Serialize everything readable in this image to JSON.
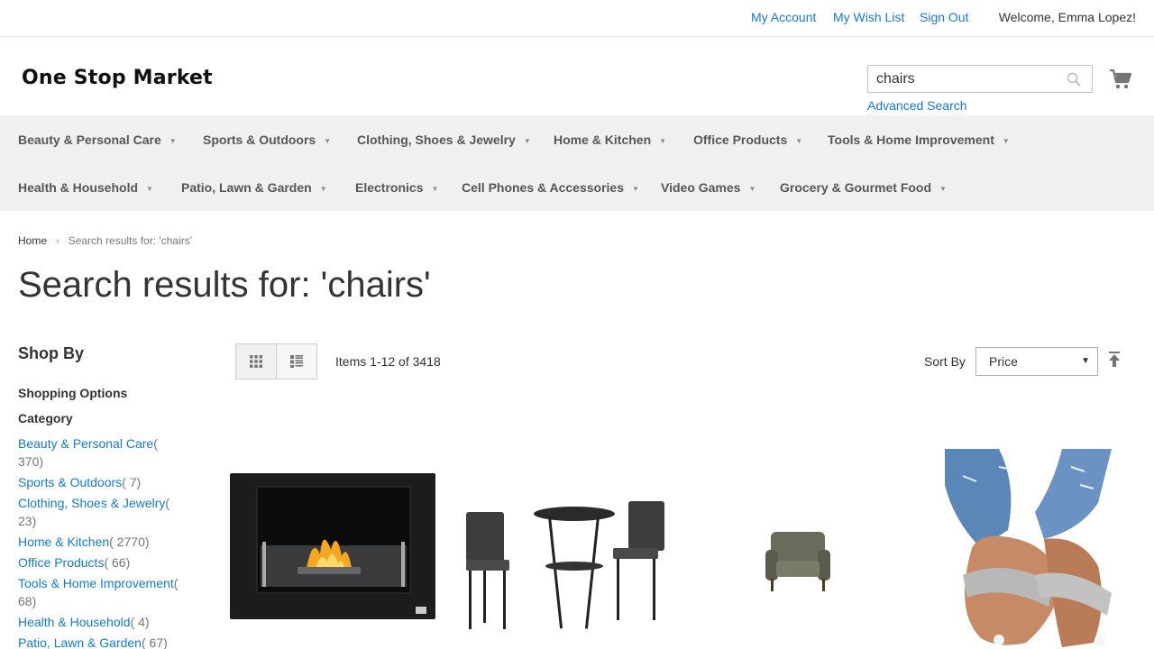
{
  "topbar": {
    "my_account": "My Account",
    "wish_list": "My Wish List",
    "sign_out": "Sign Out",
    "welcome": "Welcome, Emma Lopez!"
  },
  "header": {
    "logo": "One Stop Market",
    "search_value": "chairs",
    "advanced_search": "Advanced Search"
  },
  "nav": {
    "row1": [
      "Beauty & Personal Care",
      "Sports & Outdoors",
      "Clothing, Shoes & Jewelry",
      "Home & Kitchen",
      "Office Products",
      "Tools & Home Improvement"
    ],
    "row2": [
      "Health & Household",
      "Patio, Lawn & Garden",
      "Electronics",
      "Cell Phones & Accessories",
      "Video Games",
      "Grocery & Gourmet Food"
    ]
  },
  "breadcrumb": {
    "home": "Home",
    "current": "Search results for: 'chairs'"
  },
  "page_title": "Search results for: 'chairs'",
  "sidebar": {
    "shop_by": "Shop By",
    "shopping_options": "Shopping Options",
    "category": "Category",
    "categories": [
      {
        "label": "Beauty & Personal Care",
        "count": "( 370)"
      },
      {
        "label": "Sports & Outdoors",
        "count": "( 7)"
      },
      {
        "label": "Clothing, Shoes & Jewelry",
        "count": "( 23)"
      },
      {
        "label": "Home & Kitchen",
        "count": "( 2770)"
      },
      {
        "label": "Office Products",
        "count": "( 66)"
      },
      {
        "label": "Tools & Home Improvement",
        "count": "( 68)"
      },
      {
        "label": "Health & Household",
        "count": "( 4)"
      },
      {
        "label": "Patio, Lawn & Garden",
        "count": "( 67)"
      }
    ]
  },
  "toolbar": {
    "items_count": "Items 1-12 of 3418",
    "sort_label": "Sort By",
    "sort_value": "Price"
  },
  "colors": {
    "link": "#1979c3",
    "nav_bg": "#f0f0f0"
  }
}
